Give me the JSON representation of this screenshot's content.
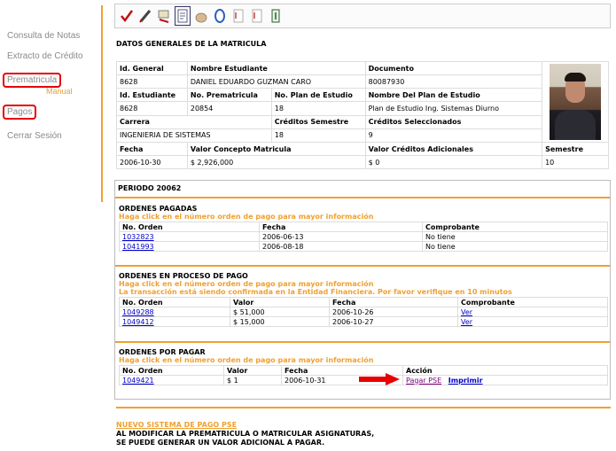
{
  "sidebar": {
    "items": [
      {
        "label": "Consulta de Notas"
      },
      {
        "label": "Extracto de Crédito"
      },
      {
        "label": "Prematricula"
      },
      {
        "label": "Pagos"
      },
      {
        "label": "Cerrar Sesión"
      }
    ],
    "prematricula_sub": "Manual"
  },
  "toolbar": {
    "icons": [
      "check-icon",
      "pencil-icon",
      "flag-icon",
      "document-icon",
      "hand-icon",
      "circle-icon",
      "report-icon",
      "report-alt-icon",
      "exit-icon"
    ]
  },
  "general": {
    "title": "DATOS GENERALES DE LA MATRICULA",
    "h_id_general": "Id. General",
    "h_nombre": "Nombre Estudiante",
    "h_documento": "Documento",
    "id_general": "8628",
    "nombre": "DANIEL EDUARDO GUZMAN CARO",
    "documento": "80087930",
    "h_id_estudiante": "Id. Estudiante",
    "h_no_prematricula": "No. Prematricula",
    "h_no_plan": "No. Plan de Estudio",
    "h_nombre_plan": "Nombre Del Plan de Estudio",
    "id_estudiante": "8628",
    "no_prematricula": "20854",
    "no_plan": "18",
    "nombre_plan": "Plan de Estudio Ing. Sistemas Diurno",
    "h_carrera": "Carrera",
    "h_creditos_semestre": "Créditos Semestre",
    "h_creditos_sel": "Créditos Seleccionados",
    "carrera": "INGENIERIA DE SISTEMAS",
    "creditos_semestre": "18",
    "creditos_sel": "9",
    "h_fecha": "Fecha",
    "h_valor_concepto": "Valor Concepto Matricula",
    "h_valor_adicionales": "Valor Créditos Adicionales",
    "h_semestre": "Semestre",
    "fecha": "2006-10-30",
    "valor_concepto": "$ 2,926,000",
    "valor_adicionales": "$ 0",
    "semestre": "10"
  },
  "periodo": {
    "title": "PERIODO 20062",
    "pagadas": {
      "title": "ORDENES PAGADAS",
      "note": "Haga click en el número orden de pago para mayor información",
      "h_orden": "No. Orden",
      "h_fecha": "Fecha",
      "h_comprobante": "Comprobante",
      "rows": [
        {
          "orden": "1032823",
          "fecha": "2006-06-13",
          "comprobante": "No tiene"
        },
        {
          "orden": "1041993",
          "fecha": "2006-08-18",
          "comprobante": "No tiene"
        }
      ]
    },
    "proceso": {
      "title": "ORDENES EN PROCESO DE PAGO",
      "note": "Haga click en el número orden de pago para mayor información",
      "note2": "La transacción está siendo confirmada en la Entidad Financiera. Por favor verifique en 10 minutos",
      "h_orden": "No. Orden",
      "h_valor": "Valor",
      "h_fecha": "Fecha",
      "h_comprobante": "Comprobante",
      "rows": [
        {
          "orden": "1049288",
          "valor": "$ 51,000",
          "fecha": "2006-10-26",
          "comprobante": "Ver"
        },
        {
          "orden": "1049412",
          "valor": "$ 15,000",
          "fecha": "2006-10-27",
          "comprobante": "Ver"
        }
      ]
    },
    "por_pagar": {
      "title": "ORDENES POR PAGAR",
      "note": "Haga click en el número orden de pago para mayor información",
      "h_orden": "No. Orden",
      "h_valor": "Valor",
      "h_fecha": "Fecha",
      "h_accion": "Acción",
      "rows": [
        {
          "orden": "1049421",
          "valor": "$ 1",
          "fecha": "2006-10-31",
          "pagar": "Pagar PSE",
          "imprimir": "Imprimir"
        }
      ]
    }
  },
  "footer": {
    "link": "NUEVO SISTEMA DE PAGO PSE",
    "line1": "AL MODIFICAR LA PREMATRICULA O MATRICULAR ASIGNATURAS,",
    "line2": "SE PUEDE GENERAR UN VALOR ADICIONAL A PAGAR."
  },
  "colors": {
    "accent": "#f0a030",
    "highlight_box": "#e60000",
    "arrow": "#e60000",
    "link": "#0000cc"
  }
}
